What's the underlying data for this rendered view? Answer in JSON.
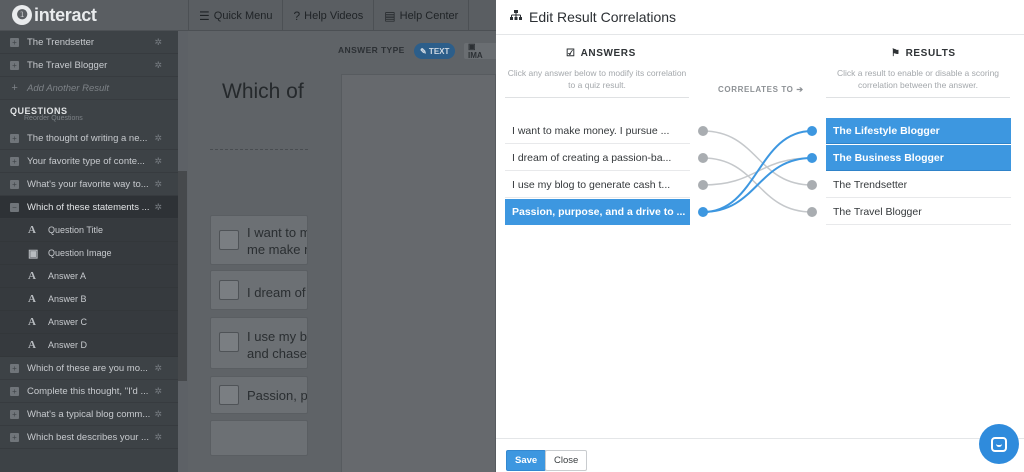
{
  "app": {
    "logo": "interact"
  },
  "topnav": [
    {
      "icon": "menu-icon",
      "glyph": "☰",
      "label": "Quick Menu"
    },
    {
      "icon": "help-icon",
      "glyph": "?",
      "label": "Help Videos"
    },
    {
      "icon": "book-icon",
      "glyph": "▤",
      "label": "Help Center"
    }
  ],
  "sidebar": {
    "results": [
      {
        "label": "The Trendsetter"
      },
      {
        "label": "The Travel Blogger"
      }
    ],
    "add_result": "Add Another Result",
    "questions_heading": "QUESTIONS",
    "reorder": "Reorder Questions",
    "questions_before": [
      {
        "label": "The thought of writing a ne..."
      },
      {
        "label": "Your favorite type of conte..."
      },
      {
        "label": "What's your favorite way to..."
      },
      {
        "label": "Which of these statements ..."
      }
    ],
    "children": [
      {
        "icon": "A",
        "label": "Question Title"
      },
      {
        "icon": "▣",
        "label": "Question Image"
      },
      {
        "icon": "A",
        "label": "Answer A"
      },
      {
        "icon": "A",
        "label": "Answer B"
      },
      {
        "icon": "A",
        "label": "Answer C"
      },
      {
        "icon": "A",
        "label": "Answer D"
      }
    ],
    "questions_after": [
      {
        "label": "Which of these are you mo..."
      },
      {
        "label": "Complete this thought, \"I'd ..."
      },
      {
        "label": "What's a typical blog comm..."
      },
      {
        "label": "Which best describes your ..."
      }
    ]
  },
  "editor": {
    "answer_type_label": "ANSWER TYPE",
    "type_text": "✎ TEXT",
    "type_image": "▣ IMA",
    "question_title": "Which of",
    "options": [
      {
        "line1": "I want to m",
        "line2": "me make m"
      },
      {
        "line1": "I dream of",
        "line2": ""
      },
      {
        "line1": "I use my b",
        "line2": "and chase"
      },
      {
        "line1": "Passion, p",
        "line2": ""
      }
    ]
  },
  "modal": {
    "title": "Edit Result Correlations",
    "answers_heading": "ANSWERS",
    "answers_sub": "Click any answer below to modify its correlation to a quiz result.",
    "correlates_to": "CORRELATES TO ➔",
    "results_heading": "RESULTS",
    "results_sub": "Click a result to enable or disable a scoring correlation between the answer.",
    "answers": [
      {
        "label": "I want to make money. I pursue ...",
        "selected": false
      },
      {
        "label": "I dream of creating a passion-ba...",
        "selected": false
      },
      {
        "label": "I use my blog to generate cash t...",
        "selected": false
      },
      {
        "label": "Passion, purpose, and a drive to ...",
        "selected": true
      }
    ],
    "results": [
      {
        "label": "The Lifestyle Blogger",
        "enabled": true
      },
      {
        "label": "The Business Blogger",
        "enabled": true
      },
      {
        "label": "The Trendsetter",
        "enabled": false
      },
      {
        "label": "The Travel Blogger",
        "enabled": false
      }
    ],
    "links": [
      {
        "from": 0,
        "to": 2
      },
      {
        "from": 1,
        "to": 3
      },
      {
        "from": 2,
        "to": 1
      },
      {
        "from": 3,
        "to": 0
      },
      {
        "from": 3,
        "to": 1
      }
    ],
    "save_label": "Save",
    "close_label": "Close",
    "accent_color": "#3d97e0",
    "link_color": "#c5c8cb"
  }
}
